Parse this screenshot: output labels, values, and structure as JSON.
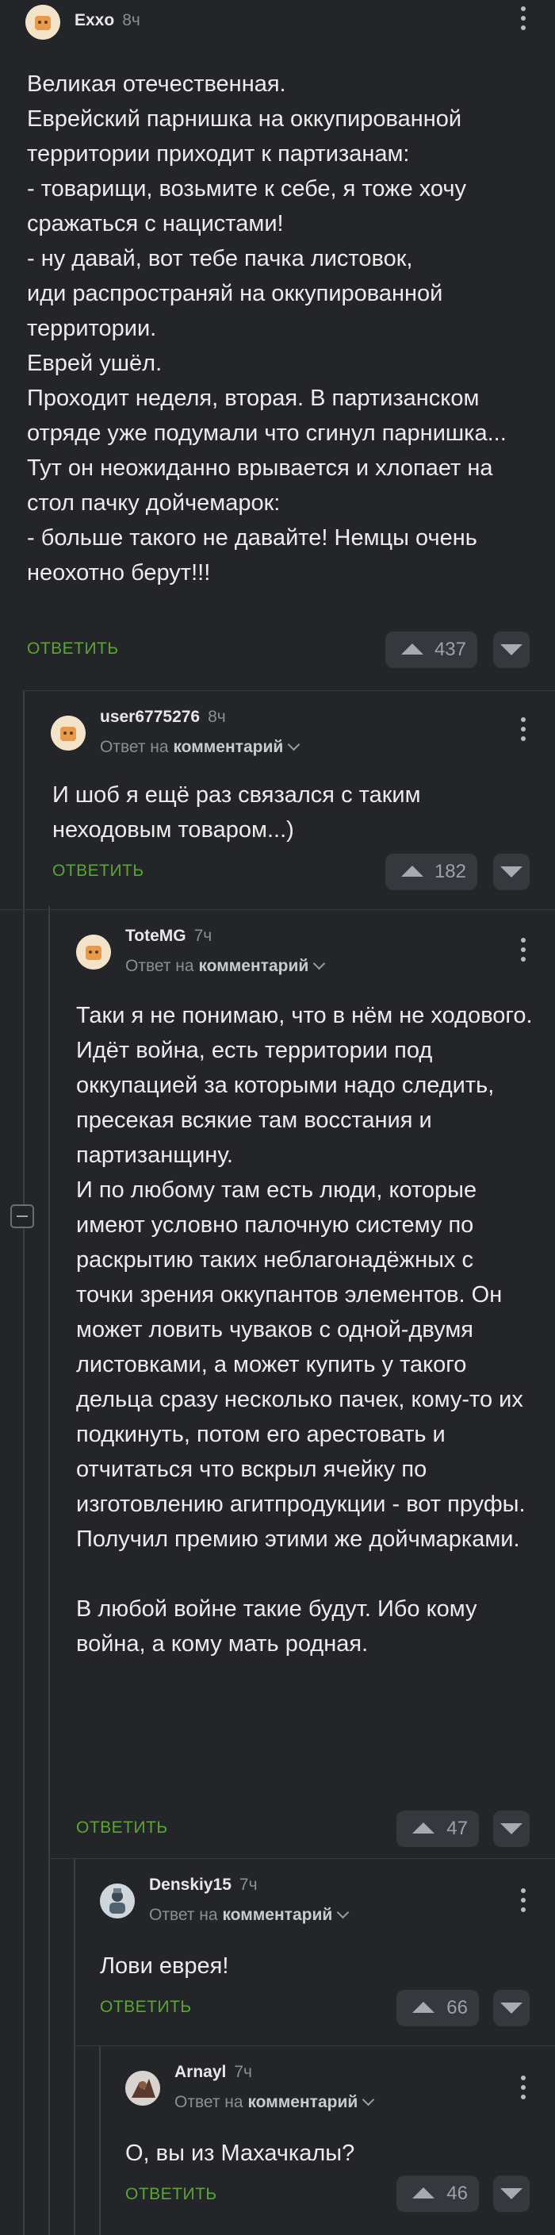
{
  "comments": [
    {
      "username": "Exxo",
      "time": "8ч",
      "text": "Великая отечественная.\nЕврейский парнишка на оккупированной территории приходит к партизанам:\n- товарищи, возьмите к себе, я тоже хочу сражаться с нацистами!\n- ну давай, вот тебе пачка листовок,\nиди распространяй на оккупированной территории.\nЕврей ушёл.\nПроходит неделя, вторая. В партизанском отряде уже подумали что сгинул парнишка...\nТут он неожиданно врывается и хлопает на стол пачку дойчемарок:\n- больше такого не давайте! Немцы очень неохотно берут!!!",
      "reply_label": "ОТВЕТИТЬ",
      "votes": "437"
    },
    {
      "username": "user6775276",
      "time": "8ч",
      "reply_prefix": "Ответ на",
      "reply_target": "комментарий",
      "text": "И шоб я ещё раз связался с таким неходовым товаром...)",
      "reply_label": "ОТВЕТИТЬ",
      "votes": "182"
    },
    {
      "username": "ToteMG",
      "time": "7ч",
      "reply_prefix": "Ответ на",
      "reply_target": "комментарий",
      "text": "Таки я не понимаю, что в нём не ходового.\nИдёт война, есть территории под оккупацией за которыми надо следить, пресекая всякие там восстания и партизанщину.\nИ по любому там есть люди, которые имеют условно палочную систему по раскрытию таких неблагонадёжных с точки зрения оккупантов элементов. Он может ловить чуваков с одной-двумя листовками, а может купить у такого дельца сразу несколько пачек, кому-то их подкинуть, потом его арестовать и отчитаться что вскрыл ячейку по изготовлению агитпродукции - вот пруфы.\nПолучил премию этими же дойчмарками.\n\nВ любой войне такие будут. Ибо кому война, а кому мать родная.",
      "reply_label": "ОТВЕТИТЬ",
      "votes": "47"
    },
    {
      "username": "Denskiy15",
      "time": "7ч",
      "reply_prefix": "Ответ на",
      "reply_target": "комментарий",
      "text": "Лови еврея!",
      "reply_label": "ОТВЕТИТЬ",
      "votes": "66"
    },
    {
      "username": "Arnayl",
      "time": "7ч",
      "reply_prefix": "Ответ на",
      "reply_target": "комментарий",
      "text": "О, вы из Махачкалы?",
      "reply_label": "ОТВЕТИТЬ",
      "votes": "46"
    }
  ],
  "icons": {
    "more": "more-vertical-icon",
    "upvote": "arrow-up-icon",
    "downvote": "arrow-down-icon",
    "collapse": "collapse-minus-icon",
    "expand": "chevron-down-icon"
  },
  "colors": {
    "background": "#232528",
    "reply_accent": "#5aa536",
    "vote_button": "#35383d"
  }
}
